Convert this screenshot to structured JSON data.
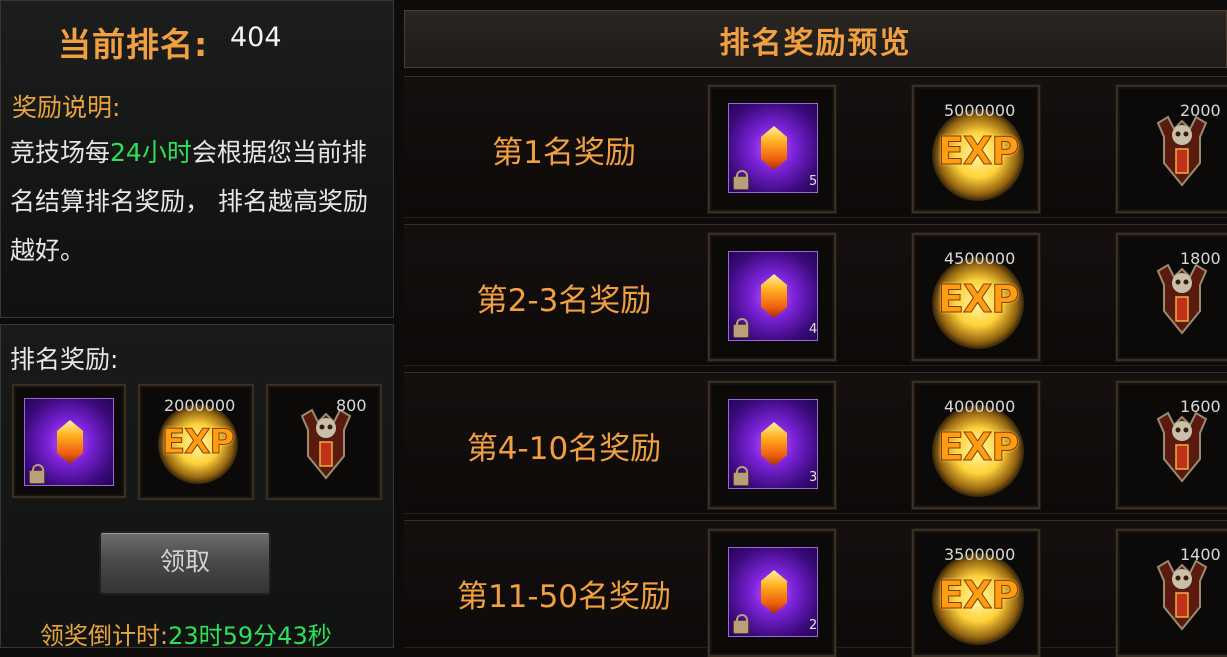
{
  "current_rank": {
    "label": "当前排名:",
    "value": "404"
  },
  "reward_info": {
    "title": "奖励说明:",
    "text_before": "竞技场每",
    "text_highlight": "24小时",
    "text_after": "会根据您当前排名结算排名奖励， 排名越高奖励越好。"
  },
  "rank_rewards": {
    "title": "排名奖励:",
    "items": [
      {
        "type": "crystal",
        "icon": "orange-crystal-icon",
        "count": ""
      },
      {
        "type": "exp",
        "icon": "exp-icon",
        "amount": "2000000"
      },
      {
        "type": "emblem",
        "icon": "demon-shield-emblem-icon",
        "amount": "800"
      }
    ],
    "claim_button": "领取",
    "countdown_label": "领奖倒计时:",
    "countdown_value": "23时59分43秒"
  },
  "preview": {
    "title": "排名奖励预览",
    "tiers": [
      {
        "label": "第1名奖励",
        "crystal_count": "5",
        "exp": "5000000",
        "emblem": "2000"
      },
      {
        "label": "第2-3名奖励",
        "crystal_count": "4",
        "exp": "4500000",
        "emblem": "1800"
      },
      {
        "label": "第4-10名奖励",
        "crystal_count": "3",
        "exp": "4000000",
        "emblem": "1600"
      },
      {
        "label": "第11-50名奖励",
        "crystal_count": "2",
        "exp": "3500000",
        "emblem": "1400"
      }
    ]
  },
  "colors": {
    "accent_orange": "#f0a040",
    "highlight_green": "#2ee05a",
    "crystal_purple": "#7b22d8"
  }
}
